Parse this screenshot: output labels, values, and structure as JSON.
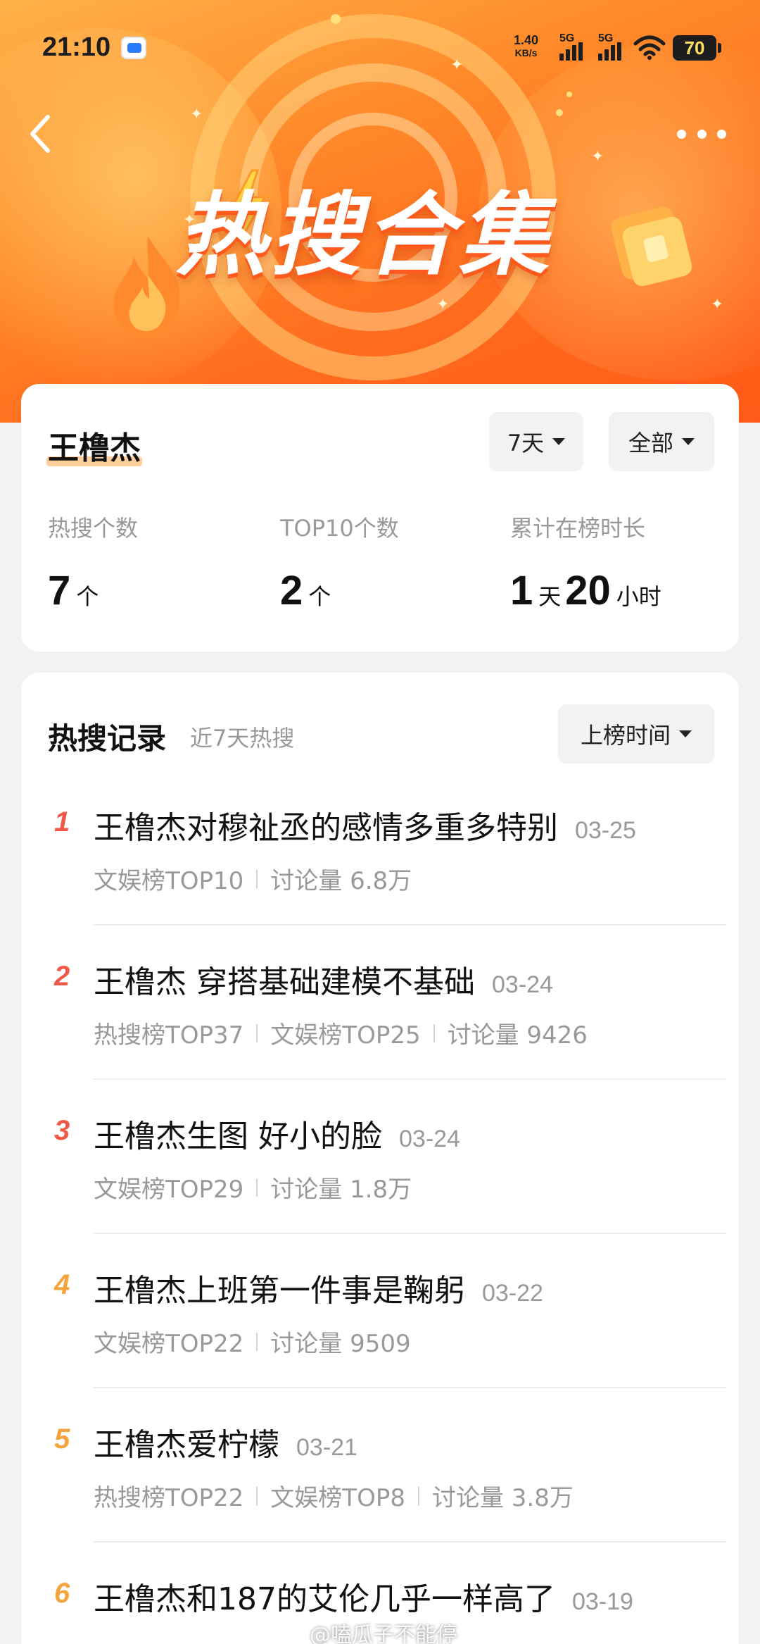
{
  "status_bar": {
    "time": "21:10",
    "net_speed_value": "1.40",
    "net_speed_unit": "KB/s",
    "signal1_label": "5G",
    "signal2_label": "5G",
    "battery": "70"
  },
  "header": {
    "banner_title": "热搜合集",
    "back_icon": "chevron-left-icon",
    "more_icon": "more-dots-icon"
  },
  "summary": {
    "name": "王橹杰",
    "range_filter": "7天",
    "scope_filter": "全部",
    "stats": [
      {
        "label": "热搜个数",
        "value": "7",
        "unit": "个"
      },
      {
        "label": "TOP10个数",
        "value": "2",
        "unit": "个"
      },
      {
        "label": "累计在榜时长",
        "value_days": "1",
        "unit_days": "天",
        "value_hours": "20",
        "unit_hours": "小时"
      }
    ]
  },
  "records": {
    "title": "热搜记录",
    "subtitle": "近7天热搜",
    "sort_label": "上榜时间",
    "items": [
      {
        "rank": "1",
        "title": "王橹杰对穆祉丞的感情多重多特别",
        "date": "03-25",
        "meta": [
          "文娱榜TOP10",
          "讨论量 6.8万"
        ]
      },
      {
        "rank": "2",
        "title": "王橹杰 穿搭基础建模不基础",
        "date": "03-24",
        "meta": [
          "热搜榜TOP37",
          "文娱榜TOP25",
          "讨论量 9426"
        ]
      },
      {
        "rank": "3",
        "title": "王橹杰生图 好小的脸",
        "date": "03-24",
        "meta": [
          "文娱榜TOP29",
          "讨论量 1.8万"
        ]
      },
      {
        "rank": "4",
        "title": "王橹杰上班第一件事是鞠躬",
        "date": "03-22",
        "meta": [
          "文娱榜TOP22",
          "讨论量 9509"
        ]
      },
      {
        "rank": "5",
        "title": "王橹杰爱柠檬",
        "date": "03-21",
        "meta": [
          "热搜榜TOP22",
          "文娱榜TOP8",
          "讨论量 3.8万"
        ]
      },
      {
        "rank": "6",
        "title": "王橹杰和187的艾伦几乎一样高了",
        "date": "03-19",
        "meta": []
      }
    ],
    "rank_colors": {
      "top3": "#f0584a",
      "other": "#f5a33b"
    }
  },
  "watermark": "@嗑瓜子不能停"
}
